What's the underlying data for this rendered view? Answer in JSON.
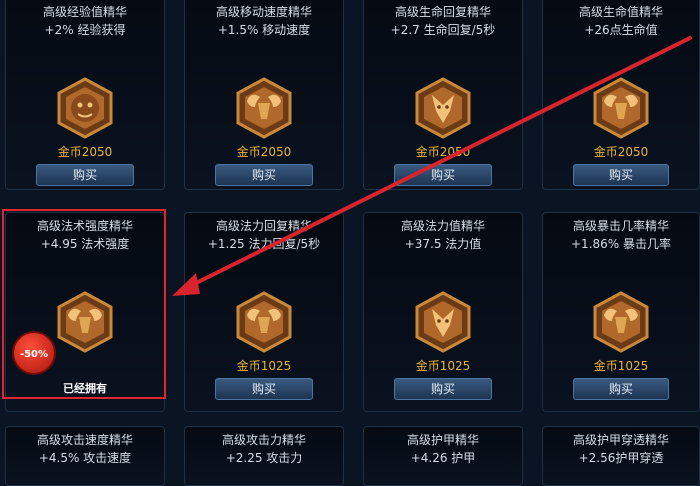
{
  "shop": {
    "buy_label": "购买",
    "owned_label": "已经拥有",
    "discount_badge": "-50%",
    "items": [
      {
        "name": "高级经验值精华",
        "stat": "+2% 经验获得",
        "price": "金币2050",
        "icon": "lion-rune-icon"
      },
      {
        "name": "高级移动速度精华",
        "stat": "+1.5% 移动速度",
        "price": "金币2050",
        "icon": "ram-rune-icon"
      },
      {
        "name": "高级生命回复精华",
        "stat": "+2.7 生命回复/5秒",
        "price": "金币2050",
        "icon": "dragon-rune-icon"
      },
      {
        "name": "高级生命值精华",
        "stat": "+26点生命值",
        "price": "金币2050",
        "icon": "ram-rune-icon"
      },
      {
        "name": "高级法术强度精华",
        "stat": "+4.95 法术强度",
        "price": "",
        "icon": "ram-rune-icon",
        "owned": true,
        "discount": true
      },
      {
        "name": "高级法力回复精华",
        "stat": "+1.25 法力回复/5秒",
        "price": "金币1025",
        "icon": "ram-rune-icon"
      },
      {
        "name": "高级法力值精华",
        "stat": "+37.5 法力值",
        "price": "金币1025",
        "icon": "dragon-rune-icon"
      },
      {
        "name": "高级暴击几率精华",
        "stat": "+1.86% 暴击几率",
        "price": "金币1025",
        "icon": "ram-rune-icon"
      },
      {
        "name": "高级攻击速度精华",
        "stat": "+4.5% 攻击速度",
        "price": "",
        "icon": ""
      },
      {
        "name": "高级攻击力精华",
        "stat": "+2.25 攻击力",
        "price": "",
        "icon": ""
      },
      {
        "name": "高级护甲精华",
        "stat": "+4.26 护甲",
        "price": "",
        "icon": ""
      },
      {
        "name": "高级护甲穿透精华",
        "stat": "+2.56护甲穿透",
        "price": "",
        "icon": ""
      }
    ]
  },
  "colors": {
    "price": "#e7b33a",
    "highlight": "#e3262e",
    "arrow": "#d8242c"
  }
}
